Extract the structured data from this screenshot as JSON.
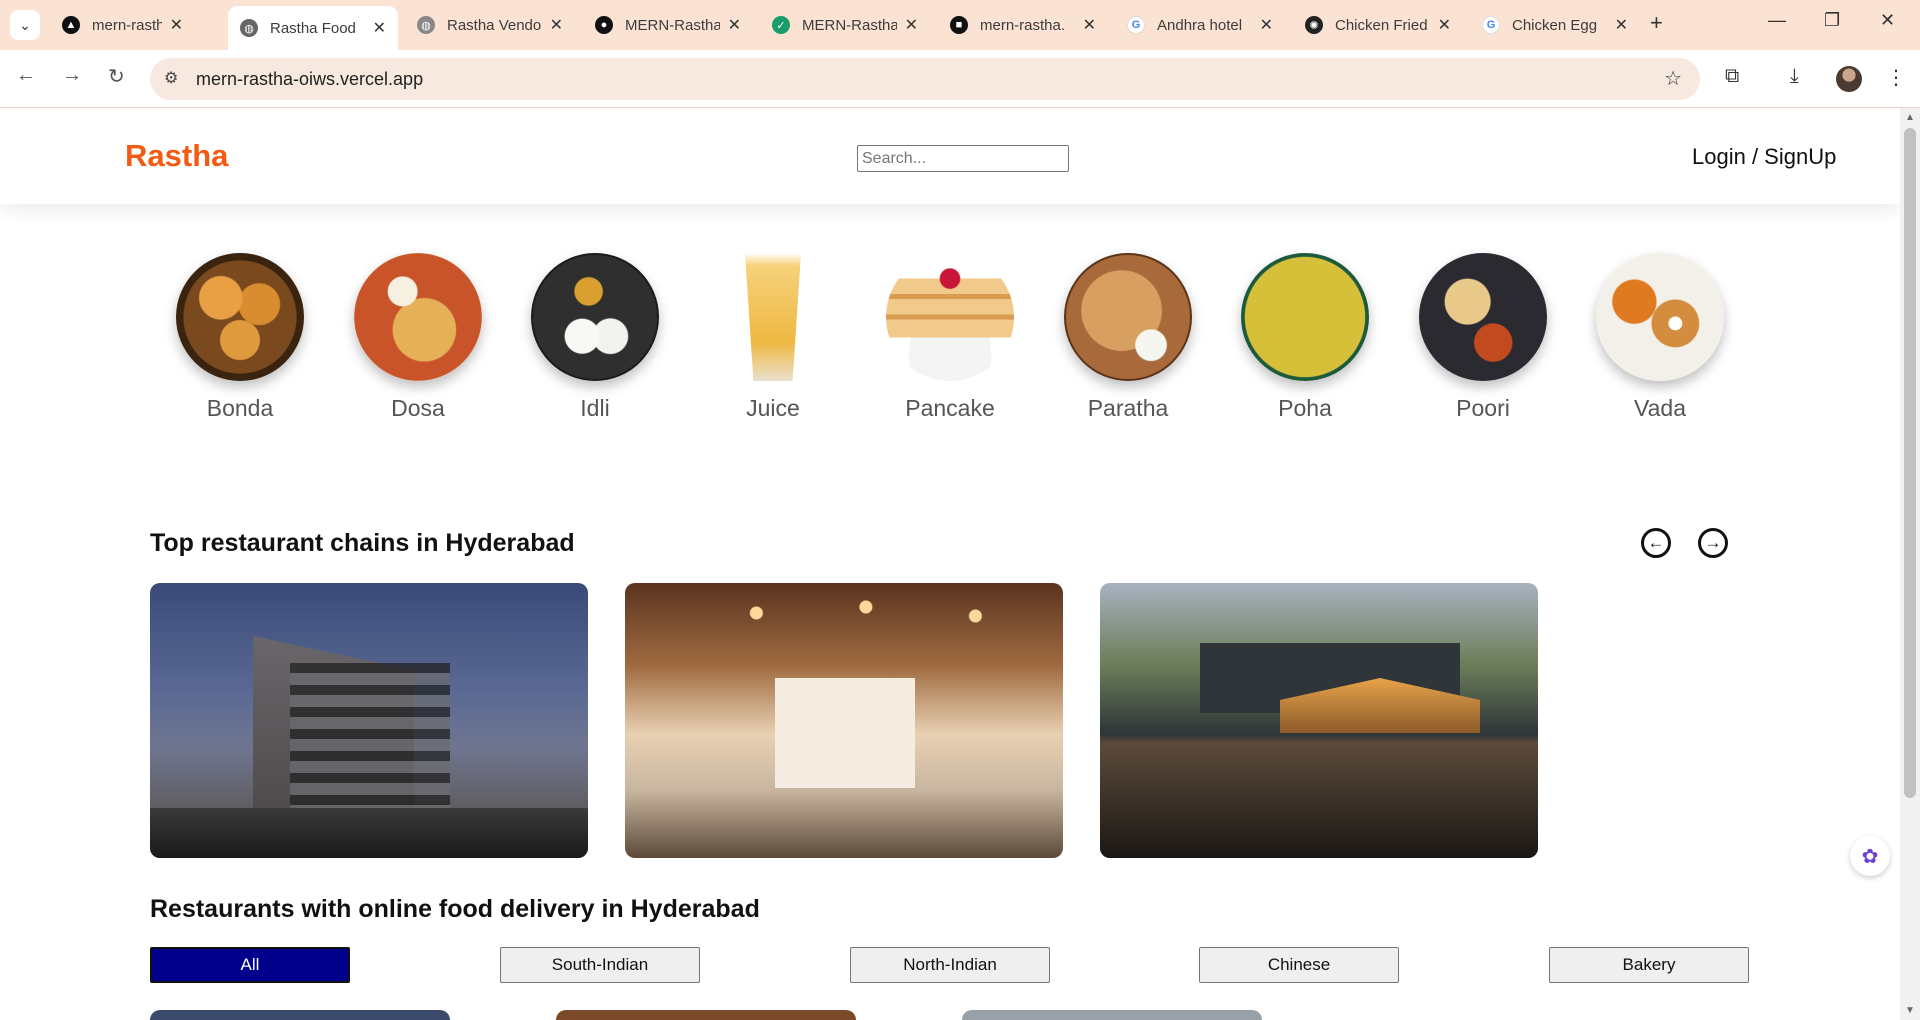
{
  "browser": {
    "tabs": [
      {
        "title": "mern-rastha-",
        "favicon_color": "#111111",
        "active": false
      },
      {
        "title": "Rastha Food",
        "favicon_color": "#555555",
        "active": true
      },
      {
        "title": "Rastha Vendo",
        "favicon_color": "#777777",
        "active": false
      },
      {
        "title": "MERN-Rastha",
        "favicon_color": "#111111",
        "active": false
      },
      {
        "title": "MERN-Rastha",
        "favicon_color": "#1a9d6b",
        "active": false
      },
      {
        "title": "mern-rastha.",
        "favicon_color": "#111111",
        "active": false
      },
      {
        "title": "Andhra hotel",
        "favicon_color": "#4285f4",
        "active": false
      },
      {
        "title": "Chicken Fried",
        "favicon_color": "#222222",
        "active": false
      },
      {
        "title": "Chicken Egg",
        "favicon_color": "#4285f4",
        "active": false
      }
    ],
    "url": "mern-rastha-oiws.vercel.app"
  },
  "header": {
    "logo": "Rastha",
    "search_placeholder": "Search...",
    "login": "Login / SignUp"
  },
  "categories": [
    {
      "name": "Bonda",
      "color": "#c47a2c"
    },
    {
      "name": "Dosa",
      "color": "#d9823a"
    },
    {
      "name": "Idli",
      "color": "#3b3b3b"
    },
    {
      "name": "Juice",
      "color": "#f0c25a"
    },
    {
      "name": "Pancake",
      "color": "#e8b878"
    },
    {
      "name": "Paratha",
      "color": "#8b5a36"
    },
    {
      "name": "Poha",
      "color": "#cbb832"
    },
    {
      "name": "Poori",
      "color": "#2d2d33"
    },
    {
      "name": "Vada",
      "color": "#d39a4e"
    }
  ],
  "chains_section": {
    "title": "Top restaurant chains in Hyderabad",
    "prev_icon": "←",
    "next_icon": "→"
  },
  "delivery_section": {
    "title": "Restaurants with online food delivery in Hyderabad",
    "filters": [
      "All",
      "South-Indian",
      "North-Indian",
      "Chinese",
      "Bakery"
    ],
    "active_filter": "All"
  }
}
